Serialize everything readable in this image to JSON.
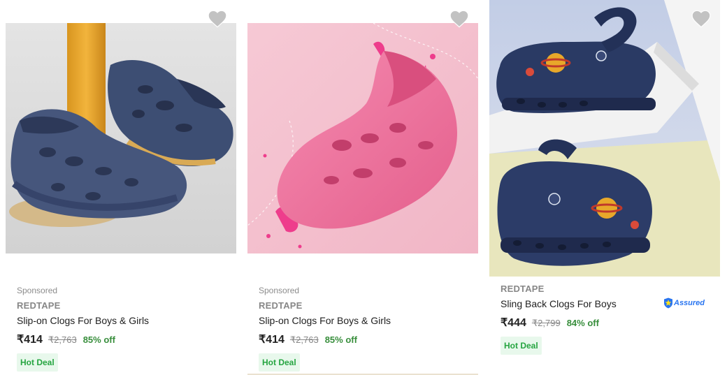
{
  "products": [
    {
      "sponsored": "Sponsored",
      "brand": "REDTAPE",
      "title": "Slip-on Clogs For Boys & Girls",
      "price": "₹414",
      "mrp": "₹2,763",
      "discount": "85% off",
      "badge": "Hot Deal",
      "image": "navy-slip-on-clogs-pair",
      "wishlist_icon": "heart-icon"
    },
    {
      "sponsored": "Sponsored",
      "brand": "REDTAPE",
      "title": "Slip-on Clogs For Boys & Girls",
      "price": "₹414",
      "mrp": "₹2,763",
      "discount": "85% off",
      "badge": "Hot Deal",
      "image": "pink-slip-on-clog",
      "wishlist_icon": "heart-icon"
    },
    {
      "brand": "REDTAPE",
      "title": "Sling Back Clogs For Boys",
      "price": "₹444",
      "mrp": "₹2,799",
      "discount": "84% off",
      "badge": "Hot Deal",
      "assured": "Assured",
      "image": "navy-sling-back-clogs-with-charms",
      "wishlist_icon": "heart-icon"
    }
  ],
  "colors": {
    "discount": "#388e3c",
    "hot_deal_bg": "#e8f8ec",
    "hot_deal_text": "#26a541",
    "assured": "#2874f0",
    "wishlist_heart": "#c2c2c2"
  }
}
